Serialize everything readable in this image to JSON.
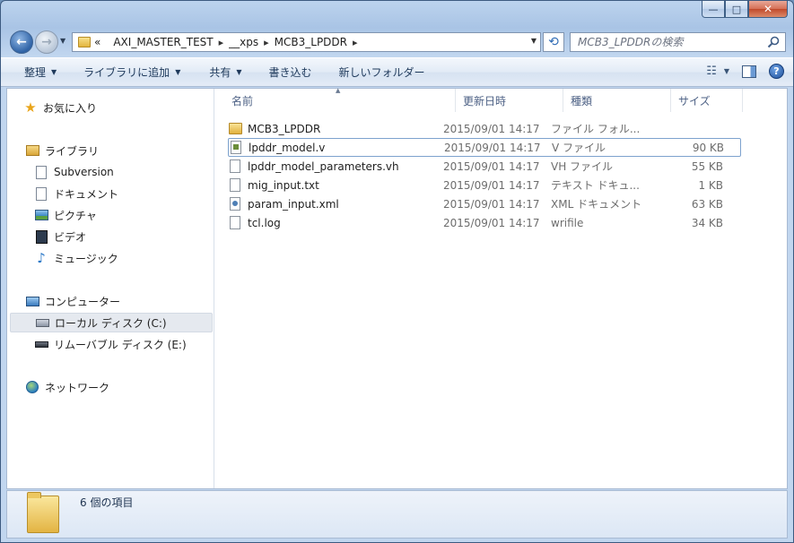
{
  "window": {
    "minimize_glyph": "—",
    "maximize_glyph": "□",
    "close_glyph": "✕"
  },
  "address": {
    "overflow": "«",
    "crumbs": [
      "AXI_MASTER_TEST",
      "__xps",
      "MCB3_LPDDR"
    ]
  },
  "search": {
    "placeholder": "MCB3_LPDDRの検索"
  },
  "toolbar": {
    "organize": "整理",
    "add_to_library": "ライブラリに追加",
    "share": "共有",
    "burn": "書き込む",
    "new_folder": "新しいフォルダー"
  },
  "sidebar": {
    "favorites": "お気に入り",
    "libraries": "ライブラリ",
    "library_items": [
      "Subversion",
      "ドキュメント",
      "ピクチャ",
      "ビデオ",
      "ミュージック"
    ],
    "computer": "コンピューター",
    "drives": [
      "ローカル ディスク (C:)",
      "リムーバブル ディスク (E:)"
    ],
    "network": "ネットワーク"
  },
  "columns": {
    "name": "名前",
    "date": "更新日時",
    "type": "種類",
    "size": "サイズ"
  },
  "files": [
    {
      "name": "MCB3_LPDDR",
      "date": "2015/09/01 14:17",
      "type": "ファイル フォル...",
      "size": "",
      "icon": "folder-icon"
    },
    {
      "name": "lpddr_model.v",
      "date": "2015/09/01 14:17",
      "type": "V ファイル",
      "size": "90 KB",
      "icon": "v-file-icon"
    },
    {
      "name": "lpddr_model_parameters.vh",
      "date": "2015/09/01 14:17",
      "type": "VH ファイル",
      "size": "55 KB",
      "icon": "file-icon"
    },
    {
      "name": "mig_input.txt",
      "date": "2015/09/01 14:17",
      "type": "テキスト ドキュ...",
      "size": "1 KB",
      "icon": "text-file-icon"
    },
    {
      "name": "param_input.xml",
      "date": "2015/09/01 14:17",
      "type": "XML ドキュメント",
      "size": "63 KB",
      "icon": "xml-file-icon"
    },
    {
      "name": "tcl.log",
      "date": "2015/09/01 14:17",
      "type": "wrifile",
      "size": "34 KB",
      "icon": "file-icon"
    }
  ],
  "details": {
    "count": "6 個の項目"
  },
  "colors": {
    "accent": "#2f63a6",
    "selection_border": "#7da2ce"
  }
}
